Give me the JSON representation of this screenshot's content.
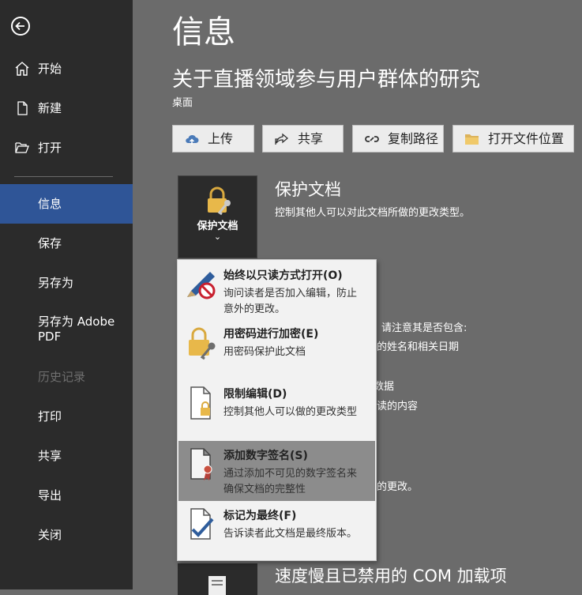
{
  "sidebar": {
    "back_icon": "back-arrow-icon",
    "items": [
      {
        "label": "开始",
        "icon": "home-icon"
      },
      {
        "label": "新建",
        "icon": "new-document-icon"
      },
      {
        "label": "打开",
        "icon": "folder-open-icon"
      },
      {
        "label": "信息",
        "active": true
      },
      {
        "label": "保存"
      },
      {
        "label": "另存为"
      },
      {
        "label": "另存为 Adobe PDF"
      },
      {
        "label": "历史记录",
        "disabled": true
      },
      {
        "label": "打印"
      },
      {
        "label": "共享"
      },
      {
        "label": "导出"
      },
      {
        "label": "关闭"
      }
    ]
  },
  "main": {
    "page_title": "信息",
    "doc_title": "关于直播领域参与用户群体的研究",
    "doc_location": "桌面",
    "actions": [
      {
        "label": "上传",
        "icon": "cloud-upload-icon"
      },
      {
        "label": "共享",
        "icon": "share-icon"
      },
      {
        "label": "复制路径",
        "icon": "link-icon"
      },
      {
        "label": "打开文件位置",
        "icon": "folder-icon"
      }
    ],
    "protect": {
      "button_label": "保护文档",
      "chevron": "⌄",
      "title": "保护文档",
      "description": "控制其他人可以对此文档所做的更改类型。"
    },
    "background_fragments": [
      "请注意其是否包含:",
      "者的姓名和相关日期",
      "数据",
      "阅读的内容",
      "存的更改。"
    ],
    "com_title": "速度慢且已禁用的 COM 加载项"
  },
  "dropdown": {
    "items": [
      {
        "title": "始终以只读方式打开(O)",
        "desc": "询问读者是否加入编辑，防止意外的更改。",
        "icon": "pencil-no-icon"
      },
      {
        "title": "用密码进行加密(E)",
        "desc": "用密码保护此文档",
        "icon": "lock-key-icon"
      },
      {
        "title": "限制编辑(D)",
        "desc": "控制其他人可以做的更改类型",
        "icon": "document-lock-icon"
      },
      {
        "title": "添加数字签名(S)",
        "desc": "通过添加不可见的数字签名来确保文档的完整性",
        "icon": "document-ribbon-icon",
        "hover": true
      },
      {
        "title": "标记为最终(F)",
        "desc": "告诉读者此文档是最终版本。",
        "icon": "document-check-icon"
      }
    ]
  },
  "colors": {
    "sidebar_bg": "#2b2b2b",
    "active_item": "#2f5597",
    "content_bg": "#6b6b6b",
    "dropdown_bg": "#f2f2f2",
    "hover_item": "#8c8c8c"
  }
}
